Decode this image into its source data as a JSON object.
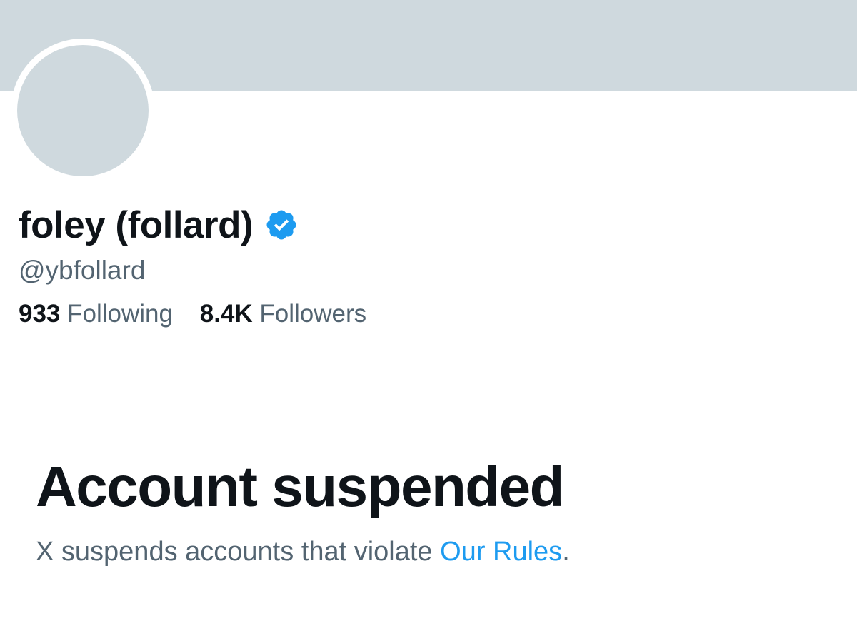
{
  "profile": {
    "display_name": "foley (follard)",
    "handle": "@ybfollard",
    "verified_icon": "verified-badge-icon",
    "following_count": "933",
    "following_label": "Following",
    "followers_count": "8.4K",
    "followers_label": "Followers"
  },
  "suspension": {
    "title": "Account suspended",
    "body_prefix": "X suspends accounts that violate ",
    "rules_link": "Our Rules",
    "body_suffix": "."
  },
  "colors": {
    "banner": "#cfd9de",
    "avatar": "#cfd9de",
    "verified": "#1d9bf0",
    "text_primary": "#0f1419",
    "text_secondary": "#536471",
    "link": "#1d9bf0"
  }
}
